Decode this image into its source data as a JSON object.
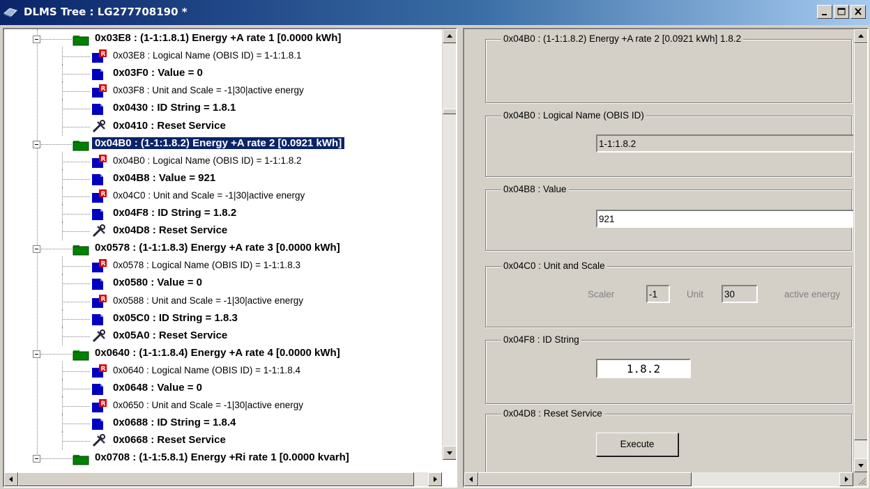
{
  "window": {
    "title": "DLMS Tree : LG277708190 *",
    "colors": {
      "titlebar_start": "#0a246a",
      "titlebar_end": "#a6caf0",
      "selection": "#0a246a"
    }
  },
  "tree": {
    "rows": [
      {
        "type": "group",
        "text": "0x03E8 :  (1-1:1.8.1) Energy +A   rate 1 [0.0000 kWh]",
        "selected": false
      },
      {
        "type": "attr-r",
        "text": "0x03E8 : Logical Name (OBIS ID) = 1-1:1.8.1"
      },
      {
        "type": "attr-bold",
        "text": "0x03F0 : Value = 0"
      },
      {
        "type": "attr-r",
        "text": "0x03F8 : Unit and Scale = -1|30|active energy"
      },
      {
        "type": "attr-bold",
        "text": "0x0430 : ID String =    1.8.1"
      },
      {
        "type": "method",
        "text": "0x0410 : Reset Service"
      },
      {
        "type": "group",
        "text": "0x04B0 :  (1-1:1.8.2) Energy +A   rate 2 [0.0921 kWh]",
        "selected": true
      },
      {
        "type": "attr-r",
        "text": "0x04B0 : Logical Name (OBIS ID) = 1-1:1.8.2"
      },
      {
        "type": "attr-bold",
        "text": "0x04B8 : Value = 921"
      },
      {
        "type": "attr-r",
        "text": "0x04C0 : Unit and Scale = -1|30|active energy"
      },
      {
        "type": "attr-bold",
        "text": "0x04F8 : ID String =    1.8.2"
      },
      {
        "type": "method",
        "text": "0x04D8 : Reset Service"
      },
      {
        "type": "group",
        "text": "0x0578 :  (1-1:1.8.3) Energy +A   rate 3 [0.0000 kWh]",
        "selected": false
      },
      {
        "type": "attr-r",
        "text": "0x0578 : Logical Name (OBIS ID) = 1-1:1.8.3"
      },
      {
        "type": "attr-bold",
        "text": "0x0580 : Value = 0"
      },
      {
        "type": "attr-r",
        "text": "0x0588 : Unit and Scale = -1|30|active energy"
      },
      {
        "type": "attr-bold",
        "text": "0x05C0 : ID String =    1.8.3"
      },
      {
        "type": "method",
        "text": "0x05A0 : Reset Service"
      },
      {
        "type": "group",
        "text": "0x0640 :  (1-1:1.8.4) Energy +A   rate 4 [0.0000 kWh]",
        "selected": false
      },
      {
        "type": "attr-r",
        "text": "0x0640 : Logical Name (OBIS ID) = 1-1:1.8.4"
      },
      {
        "type": "attr-bold",
        "text": "0x0648 : Value = 0"
      },
      {
        "type": "attr-r",
        "text": "0x0650 : Unit and Scale = -1|30|active energy"
      },
      {
        "type": "attr-bold",
        "text": "0x0688 : ID String =    1.8.4"
      },
      {
        "type": "method",
        "text": "0x0668 : Reset Service"
      },
      {
        "type": "group",
        "text": "0x0708 :  (1-1:5.8.1) Energy +Ri   rate 1 [0.0000 kvarh]",
        "selected": false
      }
    ]
  },
  "props": {
    "header_legend": "0x04B0 : (1-1:1.8.2) Energy +A   rate 2 [0.0921 kWh]   1.8.2",
    "logical_name": {
      "legend": "0x04B0 : Logical Name (OBIS ID)",
      "value": "1-1:1.8.2"
    },
    "value": {
      "legend": "0x04B8 : Value",
      "value": "921"
    },
    "unit_scale": {
      "legend": "0x04C0 : Unit and Scale",
      "scaler_label": "Scaler",
      "scaler": "-1",
      "unit_label": "Unit",
      "unit": "30",
      "unit_text": "active energy"
    },
    "id_string": {
      "legend": "0x04F8 : ID String",
      "value": "1.8.2"
    },
    "reset": {
      "legend": "0x04D8 : Reset Service",
      "button": "Execute"
    }
  }
}
